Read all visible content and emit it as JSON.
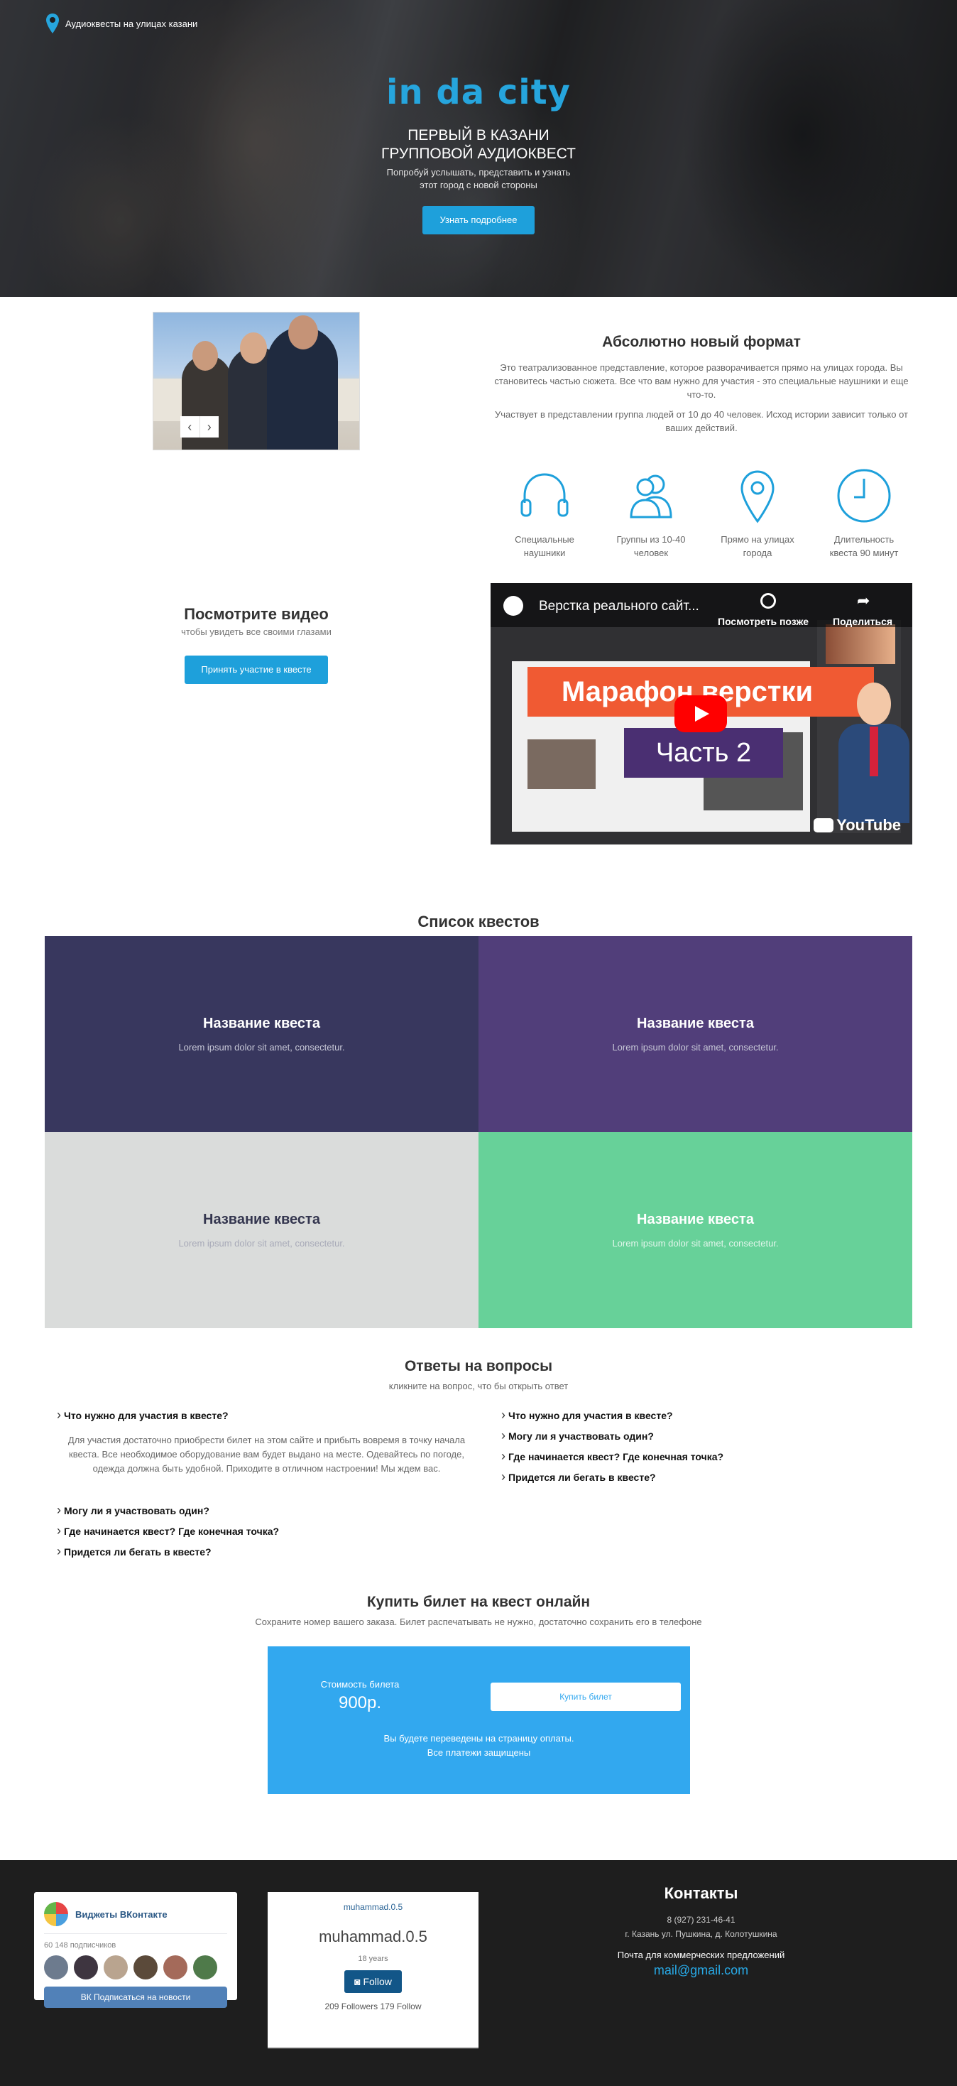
{
  "hero": {
    "tagline": "Аудиоквесты на улицах казани",
    "logo": "in da city",
    "title_line1": "ПЕРВЫЙ В КАЗАНИ",
    "title_line2": "ГРУППОВОЙ АУДИОКВЕСТ",
    "subtitle_line1": "Попробуй услышать, представить и узнать",
    "subtitle_line2": "этот город с новой стороны",
    "button": "Узнать подробнее"
  },
  "format": {
    "title": "Абсолютно новый формат",
    "p1": "Это театрализованное представление, которое разворачивается прямо на улицах города. Вы становитесь частью сюжета. Все что вам нужно для участия - это специальные наушники и еще что-то.",
    "p2": "Участвует в представлении группа людей от 10 до 40 человек. Исход истории зависит только от ваших действий.",
    "features": [
      {
        "icon": "headphones-icon",
        "line1": "Специальные",
        "line2": "наушники"
      },
      {
        "icon": "group-icon",
        "line1": "Группы из 10-40",
        "line2": "человек"
      },
      {
        "icon": "location-pin-icon",
        "line1": "Прямо на улицах",
        "line2": "города"
      },
      {
        "icon": "clock-icon",
        "line1": "Длительность",
        "line2": "квеста 90 минут"
      }
    ]
  },
  "video": {
    "title": "Посмотрите видео",
    "subtitle": "чтобы увидеть все своими глазами",
    "button": "Принять участие в квесте",
    "player_title": "Верстка реального сайт...",
    "watch_later": "Посмотреть позже",
    "share": "Поделиться",
    "banner_orange": "Марафон верстки",
    "banner_purple": "Часть 2",
    "yt_logo": "YouTube"
  },
  "quests": {
    "title": "Список квестов",
    "items": [
      {
        "name": "Название квеста",
        "desc": "Lorem ipsum dolor sit amet, consectetur.",
        "color": "#38375e"
      },
      {
        "name": "Название квеста",
        "desc": "Lorem ipsum dolor sit amet, consectetur.",
        "color": "#513e7a"
      },
      {
        "name": "Название квеста",
        "desc": "Lorem ipsum dolor sit amet, consectetur.",
        "color": "#dadcdb"
      },
      {
        "name": "Название квеста",
        "desc": "Lorem ipsum dolor sit amet, consectetur.",
        "color": "#67d199"
      }
    ]
  },
  "faq": {
    "title": "Ответы на вопросы",
    "subtitle": "кликните на вопрос, что бы открыть ответ",
    "left": [
      "Что нужно для участия в квесте?",
      "Могу ли я участвовать один?",
      "Где начинается квест? Где конечная точка?",
      "Придется ли бегать в квесте?"
    ],
    "answer": "Для участия достаточно приобрести билет на этом сайте и прибыть вовремя в точку начала квеста. Все необходимое оборудование вам будет выдано на месте. Одевайтесь по погоде, одежда должна быть удобной. Приходите в отличном настроении! Мы ждем вас.",
    "right": [
      "Что нужно для участия в квесте?",
      "Могу ли я участвовать один?",
      "Где начинается квест? Где конечная точка?",
      "Придется ли бегать в квесте?"
    ]
  },
  "buy": {
    "title": "Купить билет на квест онлайн",
    "subtitle": "Сохраните номер вашего заказа. Билет распечатывать не нужно, достаточно сохранить его в телефоне",
    "price_label": "Стоимость билета",
    "price": "900р.",
    "button": "Купить билет",
    "note_line1": "Вы будете переведены на страницу оплаты.",
    "note_line2": "Все платежи защищены",
    "color": "#32a8ef"
  },
  "footer": {
    "vk": {
      "name": "Виджеты ВКонтакте",
      "subscribers": "60 148 подписчиков",
      "button": "Подписаться на новости"
    },
    "insta": {
      "img_alt": "muhammad.0.5",
      "name": "muhammad.0.5",
      "age": "18 years",
      "button": "Follow",
      "stats": "209 Followers 179 Follow"
    },
    "contacts": {
      "title": "Контакты",
      "phone": "8 (927) 231-46-41",
      "address": "г. Казань ул. Пушкина, д. Колотушкина",
      "biz": "Почта для коммерческих предложений",
      "email": "mail@gmail.com"
    }
  }
}
